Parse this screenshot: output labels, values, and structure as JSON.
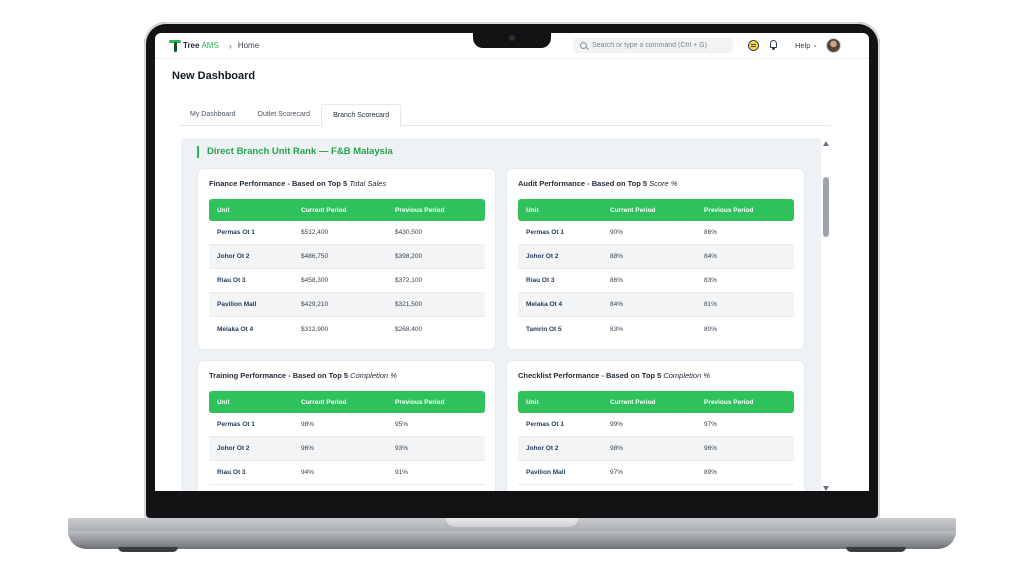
{
  "app": {
    "logo_text": "Tree",
    "logo_suffix": "AMS",
    "breadcrumb": "Home",
    "search_placeholder": "Search or type a command (Ctrl + G)",
    "help_label": "Help"
  },
  "page": {
    "title": "New Dashboard"
  },
  "tabs": [
    {
      "label": "My Dashboard",
      "active": false
    },
    {
      "label": "Outlet Scorecard",
      "active": false
    },
    {
      "label": "Branch Scorecard",
      "active": true
    }
  ],
  "section": {
    "title": "Direct Branch Unit Rank — F&B Malaysia"
  },
  "columns": [
    "Unit",
    "Current Period",
    "Previous Period"
  ],
  "cards": [
    {
      "title": "Finance Performance - Based on Top 5",
      "title_metric": "Total Sales",
      "rows": [
        [
          "Permas Ot 1",
          "$512,400",
          "$430,500"
        ],
        [
          "Johor Ot 2",
          "$486,750",
          "$398,200"
        ],
        [
          "Riau Ot 3",
          "$458,300",
          "$372,100"
        ],
        [
          "Pavilion Mall",
          "$429,210",
          "$321,500"
        ],
        [
          "Melaka Ot 4",
          "$312,900",
          "$268,400"
        ]
      ]
    },
    {
      "title": "Audit Performance - Based on Top 5",
      "title_metric": "Score %",
      "rows": [
        [
          "Permas Ot 1",
          "90%",
          "86%"
        ],
        [
          "Johor Ot 2",
          "88%",
          "84%"
        ],
        [
          "Riau Ot 3",
          "86%",
          "83%"
        ],
        [
          "Melaka Ot 4",
          "84%",
          "81%"
        ],
        [
          "Tamrin Ot 5",
          "83%",
          "80%"
        ]
      ]
    },
    {
      "title": "Training Performance - Based on Top 5",
      "title_metric": "Completion %",
      "rows": [
        [
          "Permas Ot 1",
          "98%",
          "95%"
        ],
        [
          "Johor Ot 2",
          "96%",
          "93%"
        ],
        [
          "Riau Ot 3",
          "94%",
          "91%"
        ]
      ]
    },
    {
      "title": "Checklist Performance - Based on Top 5",
      "title_metric": "Completion %",
      "rows": [
        [
          "Permas Ot 1",
          "99%",
          "97%"
        ],
        [
          "Johor Ot 2",
          "98%",
          "96%"
        ],
        [
          "Pavilion Mall",
          "97%",
          "89%"
        ]
      ]
    }
  ],
  "colors": {
    "accent": "#2fc25b",
    "section_title": "#22a447",
    "panel_bg": "#eef1f5"
  },
  "icons": [
    "search-icon",
    "chat-icon",
    "bell-icon",
    "chevron-down-icon",
    "chevron-right-icon"
  ]
}
